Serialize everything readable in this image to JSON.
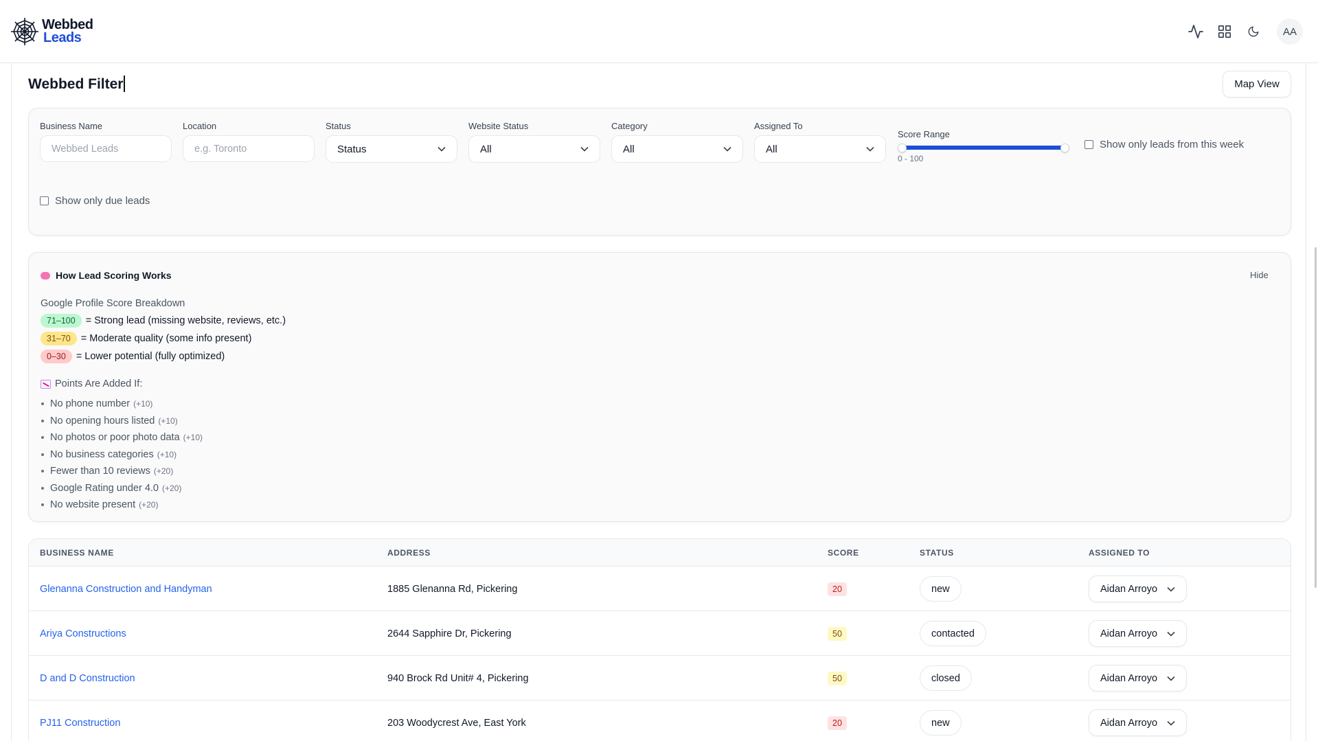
{
  "brand": {
    "line1": "Webbed",
    "line2": "Leads"
  },
  "header": {
    "icons": [
      "activity-icon",
      "grid-icon",
      "moon-icon"
    ],
    "avatar_initials": "AA"
  },
  "page": {
    "title": "Webbed Filter",
    "map_button": "Map View"
  },
  "filters": {
    "business_name": {
      "label": "Business Name",
      "placeholder": "Webbed Leads"
    },
    "location": {
      "label": "Location",
      "placeholder": "e.g. Toronto"
    },
    "status": {
      "label": "Status",
      "value": "Status"
    },
    "website_status": {
      "label": "Website Status",
      "value": "All"
    },
    "category": {
      "label": "Category",
      "value": "All"
    },
    "assigned_to": {
      "label": "Assigned To",
      "value": "All"
    },
    "score_range": {
      "label": "Score Range",
      "text": "0 - 100",
      "min": 0,
      "max": 100
    },
    "this_week_checkbox": "Show only leads from this week",
    "due_checkbox": "Show only due leads"
  },
  "scoring": {
    "title": "How Lead Scoring Works",
    "hide": "Hide",
    "subtitle": "Google Profile Score Breakdown",
    "tiers": [
      {
        "range": "71–100",
        "text": "= Strong lead (missing website, reviews, etc.)",
        "bg": "#bbf7d0",
        "fg": "#166534"
      },
      {
        "range": "31–70",
        "text": "= Moderate quality (some info present)",
        "bg": "#fde68a",
        "fg": "#854d0e"
      },
      {
        "range": "0–30",
        "text": "= Lower potential (fully optimized)",
        "bg": "#fecaca",
        "fg": "#991b1b"
      }
    ],
    "points_title": "Points Are Added If:",
    "points": [
      {
        "text": "No phone number",
        "pts": "(+10)"
      },
      {
        "text": "No opening hours listed",
        "pts": "(+10)"
      },
      {
        "text": "No photos or poor photo data",
        "pts": "(+10)"
      },
      {
        "text": "No business categories",
        "pts": "(+10)"
      },
      {
        "text": "Fewer than 10 reviews",
        "pts": "(+20)"
      },
      {
        "text": "Google Rating under 4.0",
        "pts": "(+20)"
      },
      {
        "text": "No website present",
        "pts": "(+20)"
      }
    ]
  },
  "table": {
    "columns": [
      "BUSINESS NAME",
      "ADDRESS",
      "SCORE",
      "STATUS",
      "ASSIGNED TO"
    ],
    "rows": [
      {
        "name": "Glenanna Construction and Handyman",
        "address": "1885 Glenanna Rd, Pickering",
        "score": "20",
        "score_level": "low",
        "status": "new",
        "assigned": "Aidan Arroyo"
      },
      {
        "name": "Ariya Constructions",
        "address": "2644 Sapphire Dr, Pickering",
        "score": "50",
        "score_level": "mid",
        "status": "contacted",
        "assigned": "Aidan Arroyo"
      },
      {
        "name": "D and D Construction",
        "address": "940 Brock Rd Unit# 4, Pickering",
        "score": "50",
        "score_level": "mid",
        "status": "closed",
        "assigned": "Aidan Arroyo"
      },
      {
        "name": "PJ11 Construction",
        "address": "203 Woodycrest Ave, East York",
        "score": "20",
        "score_level": "low",
        "status": "new",
        "assigned": "Aidan Arroyo"
      }
    ]
  },
  "colors": {
    "accent": "#1d4ed8",
    "link": "#2563eb",
    "score_low_bg": "#fee2e2",
    "score_low_fg": "#b91c1c",
    "score_mid_bg": "#fef9c3",
    "score_mid_fg": "#854d0e"
  }
}
